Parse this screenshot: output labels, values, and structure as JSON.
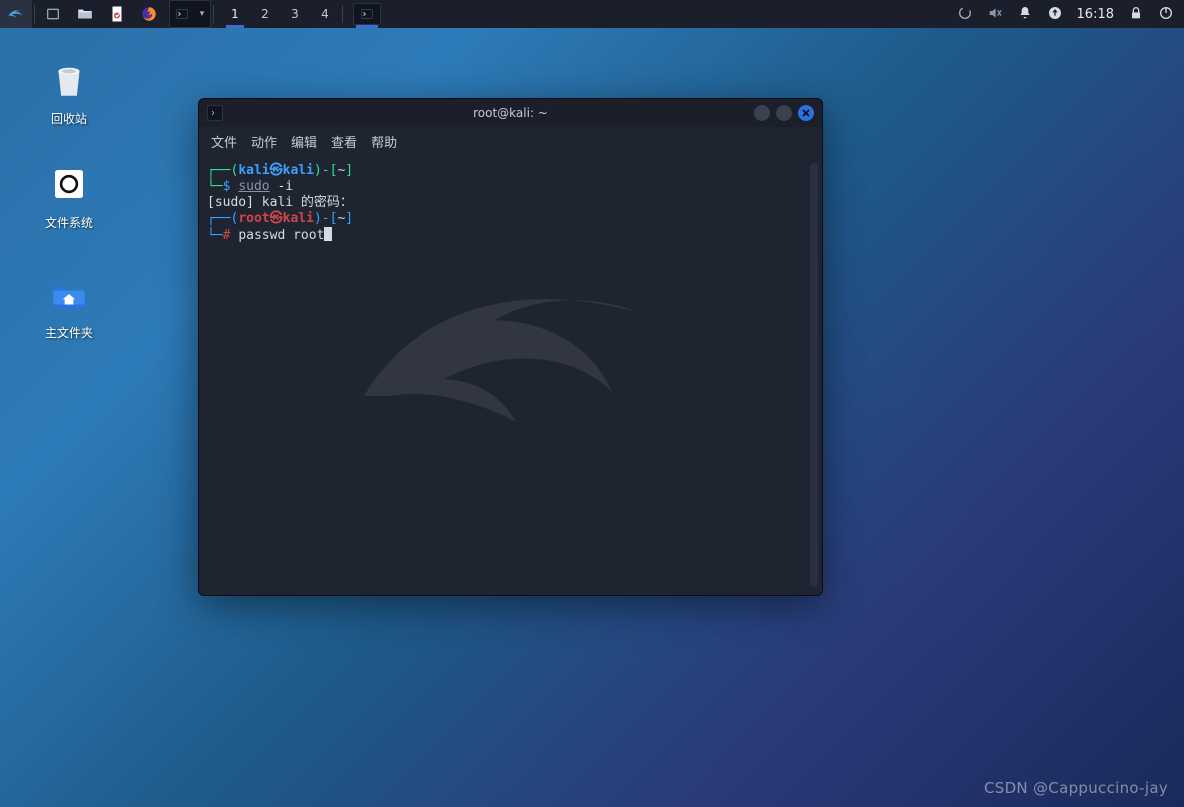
{
  "panel": {
    "workspaces": [
      "1",
      "2",
      "3",
      "4"
    ],
    "active_workspace": 0,
    "clock": "16:18"
  },
  "desktop": {
    "trash": {
      "label": "回收站"
    },
    "filesystem": {
      "label": "文件系统"
    },
    "home": {
      "label": "主文件夹"
    }
  },
  "terminal": {
    "title": "root@kali: ~",
    "menu": {
      "file": "文件",
      "actions": "动作",
      "edit": "编辑",
      "view": "查看",
      "help": "帮助"
    },
    "prompt1": {
      "user": "kali",
      "at": "㉿",
      "host": "kali",
      "open": "┌──(",
      "close": ")-[",
      "path": "~",
      "end": "]",
      "ps": "└─",
      "symbol": "$",
      "cmd": "sudo",
      "args": " -i"
    },
    "line2": "[sudo] kali 的密码：",
    "prompt2": {
      "user": "root",
      "at": "㉿",
      "host": "kali",
      "open": "┌──(",
      "close": ")-[",
      "path": "~",
      "end": "]",
      "ps": "└─",
      "symbol": "#",
      "cmd": "passwd root"
    }
  },
  "watermark": "CSDN @Cappuccino-jay"
}
